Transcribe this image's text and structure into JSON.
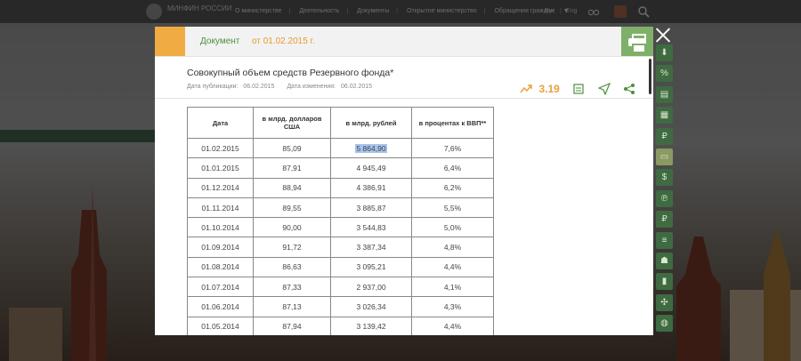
{
  "site": {
    "name": "МИНФИН РОССИИ",
    "nav": [
      "О министерстве",
      "Деятельность",
      "Документы",
      "Открытое министерство",
      "Обращения граждан"
    ],
    "langs": [
      "Рус",
      "Eng"
    ]
  },
  "modal": {
    "label": "Документ",
    "date": "от 01.02.2015 г.",
    "title": "Совокупный объем средств Резервного фонда*",
    "meta": {
      "pub_label": "Дата публикации:",
      "pub_value": "06.02.2015",
      "mod_label": "Дата изменения:",
      "mod_value": "06.02.2015"
    },
    "stat_value": "3.19"
  },
  "table": {
    "headers": [
      "Дата",
      "в млрд. долларов США",
      "в млрд. рублей",
      "в процентах к ВВП**"
    ],
    "rows": [
      [
        "01.02.2015",
        "85,09",
        "5 864,90",
        "7,6%"
      ],
      [
        "01.01.2015",
        "87,91",
        "4 945,49",
        "6,4%"
      ],
      [
        "01.12.2014",
        "88,94",
        "4 386,91",
        "6,2%"
      ],
      [
        "01.11.2014",
        "89,55",
        "3 885,87",
        "5,5%"
      ],
      [
        "01.10.2014",
        "90,00",
        "3 544,83",
        "5,0%"
      ],
      [
        "01.09.2014",
        "91,72",
        "3 387,34",
        "4,8%"
      ],
      [
        "01.08.2014",
        "86,63",
        "3 095,21",
        "4,4%"
      ],
      [
        "01.07.2014",
        "87,33",
        "2 937,00",
        "4,1%"
      ],
      [
        "01.06.2014",
        "87,13",
        "3 026,34",
        "4,3%"
      ],
      [
        "01.05.2014",
        "87,94",
        "3 139,42",
        "4,4%"
      ]
    ]
  },
  "colors": {
    "accent": "#f0ac42",
    "green": "#4c8f3c",
    "print": "#7fb069",
    "highlight": "#a7c4ee"
  }
}
